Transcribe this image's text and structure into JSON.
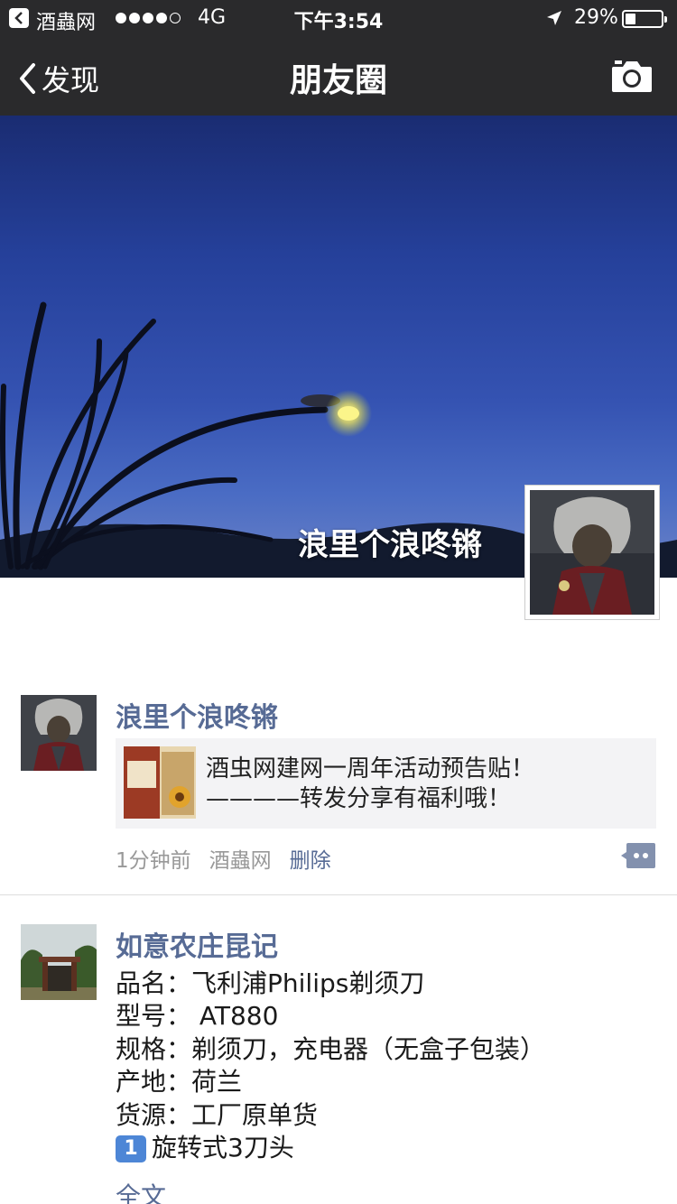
{
  "status_bar": {
    "back_app": "酒蟲网",
    "network": "4G",
    "time": "下午3:54",
    "battery": "29%",
    "battery_level": 0.29
  },
  "nav": {
    "back_label": "发现",
    "title": "朋友圈"
  },
  "cover": {
    "owner_name": "浪里个浪咚锵"
  },
  "posts": [
    {
      "author": "浪里个浪咚锵",
      "share_line1": "酒虫网建网一周年活动预告贴！",
      "share_line2": "————转发分享有福利哦！",
      "time_ago": "1分钟前",
      "source": "酒蟲网",
      "delete_label": "删除"
    },
    {
      "author": "如意农庄昆记",
      "lines": [
        "品名：飞利浦Philips剃须刀",
        "型号： AT880",
        "规格：剃须刀，充电器（无盒子包装）",
        "产地：荷兰",
        "货源：工厂原单货"
      ],
      "badge": "1",
      "list_item": "旋转式3刀头",
      "fulltext_label": "全文"
    }
  ],
  "colors": {
    "bar_bg": "#2a2a2c",
    "link": "#576b95",
    "share_bg": "#f3f3f5"
  }
}
